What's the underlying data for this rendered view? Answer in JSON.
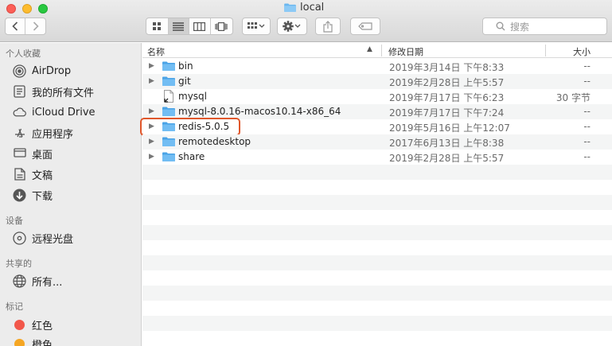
{
  "window": {
    "title": "local"
  },
  "toolbar": {
    "search_placeholder": "搜索",
    "icons": [
      "back-icon",
      "forward-icon",
      "icon-view-icon",
      "list-view-icon",
      "column-view-icon",
      "coverflow-view-icon",
      "group-icon",
      "action-gear-icon",
      "share-icon",
      "tag-icon",
      "search-icon"
    ]
  },
  "sidebar": {
    "favorites_header": "个人收藏",
    "favorites": [
      {
        "label": "AirDrop",
        "icon": "airdrop-icon"
      },
      {
        "label": "我的所有文件",
        "icon": "all-files-icon"
      },
      {
        "label": "iCloud Drive",
        "icon": "cloud-icon"
      },
      {
        "label": "应用程序",
        "icon": "applications-icon"
      },
      {
        "label": "桌面",
        "icon": "desktop-icon"
      },
      {
        "label": "文稿",
        "icon": "documents-icon"
      },
      {
        "label": "下载",
        "icon": "downloads-icon"
      }
    ],
    "devices_header": "设备",
    "devices": [
      {
        "label": "远程光盘",
        "icon": "disc-icon"
      }
    ],
    "shared_header": "共享的",
    "shared": [
      {
        "label": "所有...",
        "icon": "network-icon"
      }
    ],
    "tags_header": "标记",
    "tags": [
      {
        "label": "红色",
        "color": "#f2574a"
      },
      {
        "label": "橙色",
        "color": "#f5a623"
      }
    ]
  },
  "list": {
    "columns": {
      "name": "名称",
      "date": "修改日期",
      "size": "大小"
    },
    "rows": [
      {
        "name": "bin",
        "date": "2019年3月14日 下午8:33",
        "size": "--",
        "kind": "folder"
      },
      {
        "name": "git",
        "date": "2019年2月28日 上午5:57",
        "size": "--",
        "kind": "folder"
      },
      {
        "name": "mysql",
        "date": "2019年7月17日 下午6:23",
        "size": "30 字节",
        "kind": "alias"
      },
      {
        "name": "mysql-8.0.16-macos10.14-x86_64",
        "date": "2019年7月17日 下午7:24",
        "size": "--",
        "kind": "folder"
      },
      {
        "name": "redis-5.0.5",
        "date": "2019年5月16日 上午12:07",
        "size": "--",
        "kind": "folder",
        "highlighted": true
      },
      {
        "name": "remotedesktop",
        "date": "2017年6月13日 上午8:38",
        "size": "--",
        "kind": "folder"
      },
      {
        "name": "share",
        "date": "2019年2月28日 上午5:57",
        "size": "--",
        "kind": "folder"
      }
    ],
    "highlight_color": "#e0572b",
    "folder_color": "#5ab0ee"
  }
}
